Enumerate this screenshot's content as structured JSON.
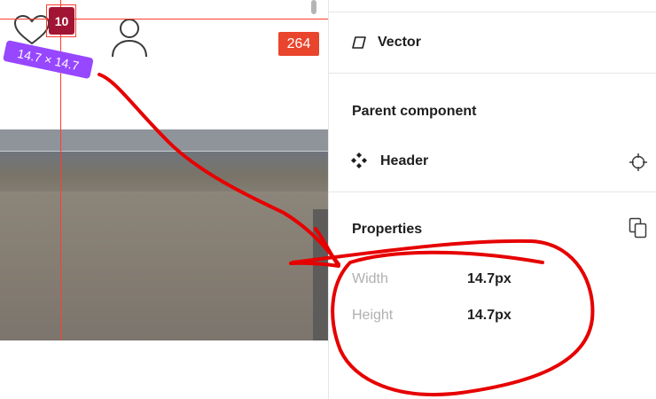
{
  "canvas": {
    "layer_badge": "10",
    "size_tag": "14.7 × 14.7",
    "count_badge": "264"
  },
  "panel": {
    "layer_name": "Vector",
    "parent_section_title": "Parent component",
    "parent_name": "Header",
    "properties_title": "Properties",
    "properties": [
      {
        "label": "Width",
        "value": "14.7px"
      },
      {
        "label": "Height",
        "value": "14.7px"
      }
    ]
  },
  "icons": {
    "vector": "vector-icon",
    "component": "component-icon",
    "target": "target-icon",
    "copy": "copy-icon",
    "heart": "heart-icon",
    "user": "user-icon"
  },
  "colors": {
    "guide": "#ff3d2e",
    "layer_badge": "#a21434",
    "size_tag": "#9747ff",
    "count_badge": "#e8452c",
    "annotation": "#e60000"
  }
}
